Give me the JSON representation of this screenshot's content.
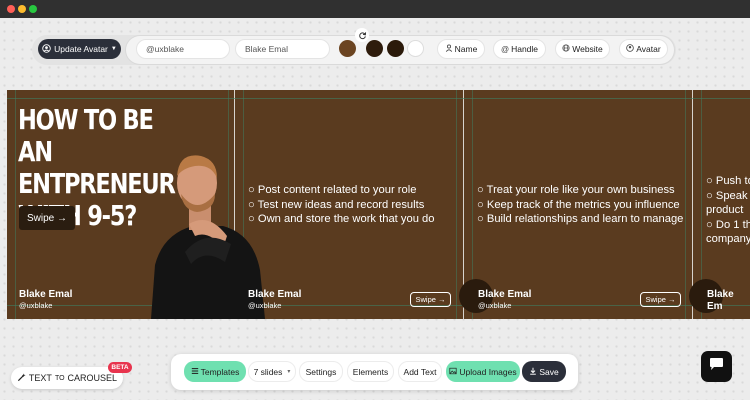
{
  "window": {
    "colors": {
      "close": "#ff5f57",
      "minimize": "#febc2e",
      "zoom": "#28c840"
    }
  },
  "top_toolbar": {
    "avatar_menu_label": "Update Avatar",
    "handle_value": "@uxblake",
    "name_value": "Blake Emal",
    "swatches": [
      "#6b4421",
      "#2e1c0c",
      "#2b1a0a",
      "#ffffff"
    ],
    "refresh_icon": "refresh-icon",
    "toggles": {
      "name": "Name",
      "handle": "Handle",
      "website": "Website",
      "avatar": "Avatar"
    }
  },
  "slides": {
    "colors": {
      "background": "#5a3b1f",
      "text": "#ffffff",
      "guides": "#3e7f63"
    },
    "slide1": {
      "title_lines": [
        "HOW TO BE AN",
        "ENTPRENEUR",
        "WITH 9-5?"
      ],
      "swipe": "Swipe →",
      "author_name": "Blake Emal",
      "author_handle": "@uxblake"
    },
    "slide2": {
      "bullets": [
        "○ Post content related to your role",
        "○ Test new ideas and record results",
        "○ Own and store the work that you do"
      ],
      "author_name": "Blake Emal",
      "author_handle": "@uxblake",
      "swipe": "Swipe →"
    },
    "slide3": {
      "bullets": [
        "○ Treat your role like your own business",
        "○ Keep track of the metrics you influence",
        "○ Build relationships and learn to manage"
      ],
      "author_name": "Blake Emal",
      "author_handle": "@uxblake",
      "swipe": "Swipe →"
    },
    "slide4": {
      "bullets": [
        "○ Push to",
        "○ Speak o",
        "product",
        "○ Do 1 thi",
        "company"
      ],
      "author_name": "Blake Em"
    }
  },
  "brand": {
    "text_part": "TEXT",
    "to": "TO",
    "carousel": "CAROUSEL",
    "badge": "BETA"
  },
  "bottom_toolbar": {
    "templates": "Templates",
    "slides_select": "7 slides",
    "settings": "Settings",
    "elements": "Elements",
    "add_text": "Add Text",
    "upload_images": "Upload Images",
    "save": "Save"
  }
}
